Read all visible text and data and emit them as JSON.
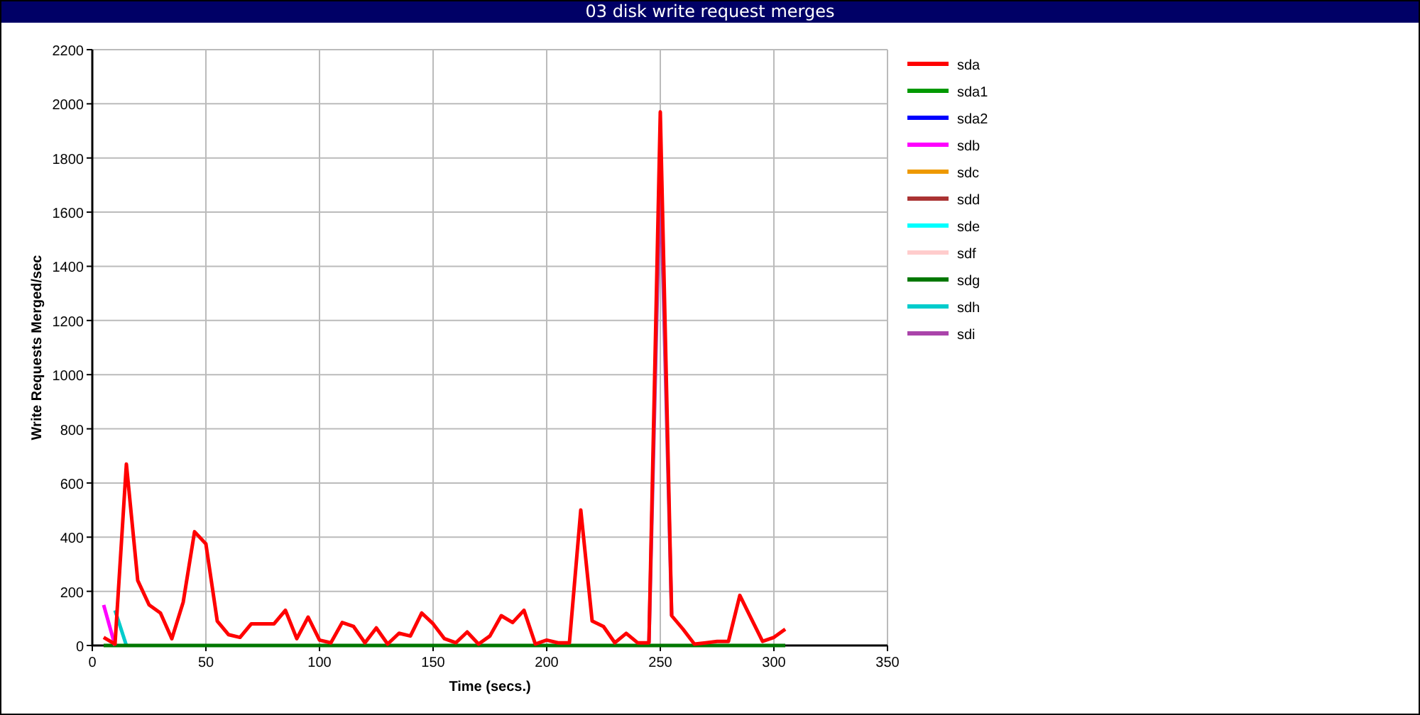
{
  "window": {
    "title": "03 disk write request merges"
  },
  "chart_data": {
    "type": "line",
    "xlabel": "Time (secs.)",
    "ylabel": "Write Requests Merged/sec",
    "grid": true,
    "legend": true,
    "x": [
      5,
      10,
      15,
      20,
      25,
      30,
      35,
      40,
      45,
      50,
      55,
      60,
      65,
      70,
      75,
      80,
      85,
      90,
      95,
      100,
      105,
      110,
      115,
      120,
      125,
      130,
      135,
      140,
      145,
      150,
      155,
      160,
      165,
      170,
      175,
      180,
      185,
      190,
      195,
      200,
      205,
      210,
      215,
      220,
      225,
      230,
      235,
      240,
      245,
      250,
      255,
      260,
      265,
      270,
      275,
      280,
      285,
      290,
      295,
      300,
      305
    ],
    "xlim": [
      0,
      350
    ],
    "ylim": [
      0,
      2200
    ],
    "xticks": [
      0,
      50,
      100,
      150,
      200,
      250,
      300,
      350
    ],
    "yticks": [
      0,
      200,
      400,
      600,
      800,
      1000,
      1200,
      1400,
      1600,
      1800,
      2000,
      2200
    ],
    "series": [
      {
        "name": "sda",
        "color": "#ff0000",
        "values": [
          30,
          5,
          670,
          240,
          150,
          120,
          25,
          160,
          420,
          375,
          90,
          40,
          30,
          80,
          80,
          80,
          130,
          25,
          105,
          20,
          10,
          85,
          70,
          10,
          65,
          5,
          45,
          35,
          120,
          80,
          25,
          10,
          50,
          5,
          35,
          110,
          85,
          130,
          5,
          20,
          10,
          10,
          500,
          90,
          70,
          10,
          45,
          10,
          10,
          1970,
          110,
          60,
          5,
          10,
          15,
          15,
          185,
          100,
          15,
          30,
          60
        ]
      },
      {
        "name": "sda1",
        "color": "#009900",
        "values": [
          null,
          null,
          null,
          null,
          null,
          null,
          null,
          null,
          null,
          null,
          null,
          null,
          null,
          null,
          null,
          null,
          null,
          null,
          null,
          null,
          null,
          null,
          null,
          null,
          null,
          null,
          null,
          null,
          null,
          null,
          null,
          null,
          null,
          null,
          null,
          null,
          null,
          null,
          null,
          null,
          null,
          null,
          null,
          null,
          null,
          null,
          null,
          null,
          null,
          null,
          null,
          null,
          null,
          null,
          null,
          null,
          null,
          null,
          null,
          null,
          null
        ]
      },
      {
        "name": "sda2",
        "color": "#0000ff",
        "values": [
          null,
          null,
          null,
          null,
          null,
          null,
          null,
          null,
          null,
          null,
          null,
          null,
          null,
          null,
          null,
          null,
          null,
          null,
          null,
          null,
          null,
          null,
          null,
          null,
          null,
          null,
          null,
          null,
          null,
          null,
          null,
          null,
          null,
          null,
          null,
          null,
          null,
          null,
          null,
          null,
          null,
          null,
          null,
          null,
          null,
          null,
          null,
          null,
          null,
          null,
          null,
          null,
          null,
          null,
          null,
          null,
          null,
          null,
          null,
          null,
          null
        ]
      },
      {
        "name": "sdb",
        "color": "#ff00ff",
        "values": [
          150,
          0,
          null,
          null,
          null,
          null,
          null,
          null,
          null,
          null,
          null,
          null,
          null,
          null,
          null,
          null,
          null,
          null,
          null,
          null,
          null,
          null,
          null,
          null,
          null,
          null,
          null,
          null,
          null,
          null,
          null,
          null,
          null,
          null,
          null,
          null,
          null,
          null,
          null,
          null,
          null,
          null,
          null,
          null,
          null,
          null,
          null,
          null,
          null,
          null,
          null,
          null,
          null,
          null,
          null,
          null,
          null,
          null,
          null,
          null,
          null
        ]
      },
      {
        "name": "sdc",
        "color": "#ee9900",
        "values": [
          null,
          null,
          null,
          null,
          null,
          null,
          null,
          null,
          null,
          null,
          null,
          null,
          null,
          null,
          null,
          null,
          null,
          null,
          null,
          null,
          null,
          null,
          null,
          null,
          null,
          null,
          null,
          null,
          null,
          null,
          null,
          null,
          null,
          null,
          null,
          null,
          null,
          null,
          null,
          null,
          null,
          null,
          null,
          null,
          null,
          null,
          null,
          null,
          null,
          null,
          null,
          null,
          null,
          null,
          null,
          null,
          null,
          null,
          null,
          null,
          null
        ]
      },
      {
        "name": "sdd",
        "color": "#aa3333",
        "values": [
          null,
          null,
          null,
          null,
          null,
          null,
          null,
          null,
          null,
          null,
          null,
          null,
          null,
          null,
          null,
          null,
          null,
          null,
          null,
          null,
          null,
          null,
          null,
          null,
          null,
          null,
          null,
          null,
          null,
          null,
          null,
          null,
          null,
          null,
          null,
          null,
          null,
          null,
          null,
          null,
          null,
          null,
          null,
          null,
          null,
          null,
          null,
          null,
          null,
          null,
          null,
          null,
          null,
          null,
          null,
          null,
          null,
          null,
          null,
          null,
          null
        ]
      },
      {
        "name": "sde",
        "color": "#00ffff",
        "values": [
          null,
          null,
          null,
          null,
          null,
          null,
          null,
          null,
          null,
          null,
          null,
          null,
          null,
          null,
          null,
          null,
          null,
          null,
          null,
          null,
          null,
          null,
          null,
          null,
          null,
          null,
          null,
          null,
          null,
          null,
          null,
          null,
          null,
          null,
          null,
          null,
          null,
          null,
          null,
          null,
          null,
          null,
          null,
          null,
          null,
          null,
          null,
          null,
          null,
          null,
          null,
          null,
          null,
          null,
          null,
          null,
          null,
          null,
          null,
          null,
          null
        ]
      },
      {
        "name": "sdf",
        "color": "#ffcccc",
        "values": [
          null,
          null,
          null,
          null,
          null,
          null,
          null,
          null,
          null,
          null,
          null,
          null,
          null,
          null,
          null,
          null,
          null,
          null,
          null,
          null,
          null,
          null,
          null,
          null,
          null,
          null,
          null,
          null,
          null,
          null,
          null,
          null,
          null,
          null,
          null,
          null,
          null,
          null,
          null,
          null,
          null,
          null,
          null,
          null,
          null,
          null,
          null,
          null,
          null,
          null,
          null,
          null,
          null,
          null,
          null,
          null,
          null,
          null,
          null,
          null,
          null
        ]
      },
      {
        "name": "sdg",
        "color": "#007700",
        "values": [
          0,
          0,
          0,
          0,
          0,
          0,
          0,
          0,
          0,
          0,
          0,
          0,
          0,
          0,
          0,
          0,
          0,
          0,
          0,
          0,
          0,
          0,
          0,
          0,
          0,
          0,
          0,
          0,
          0,
          0,
          0,
          0,
          0,
          0,
          0,
          0,
          0,
          0,
          0,
          0,
          0,
          0,
          0,
          0,
          0,
          0,
          0,
          0,
          0,
          0,
          0,
          0,
          0,
          0,
          0,
          0,
          0,
          0,
          0,
          0,
          0
        ]
      },
      {
        "name": "sdh",
        "color": "#00cccc",
        "values": [
          null,
          130,
          0,
          null,
          null,
          null,
          null,
          null,
          null,
          null,
          null,
          null,
          null,
          null,
          null,
          null,
          null,
          null,
          null,
          null,
          null,
          null,
          null,
          null,
          null,
          null,
          null,
          null,
          null,
          null,
          null,
          null,
          null,
          null,
          null,
          null,
          null,
          null,
          null,
          null,
          null,
          null,
          null,
          null,
          null,
          null,
          null,
          null,
          null,
          null,
          null,
          null,
          null,
          null,
          null,
          null,
          null,
          null,
          null,
          null,
          null
        ]
      },
      {
        "name": "sdi",
        "color": "#aa44aa",
        "values": [
          null,
          null,
          null,
          null,
          null,
          null,
          null,
          null,
          null,
          null,
          null,
          null,
          null,
          null,
          null,
          null,
          null,
          null,
          null,
          null,
          null,
          null,
          null,
          null,
          null,
          null,
          null,
          null,
          null,
          null,
          null,
          null,
          null,
          null,
          null,
          null,
          null,
          null,
          null,
          null,
          null,
          null,
          null,
          null,
          null,
          null,
          null,
          null,
          10,
          1750,
          110,
          null,
          null,
          null,
          null,
          null,
          null,
          null,
          null,
          null,
          null
        ]
      }
    ]
  }
}
